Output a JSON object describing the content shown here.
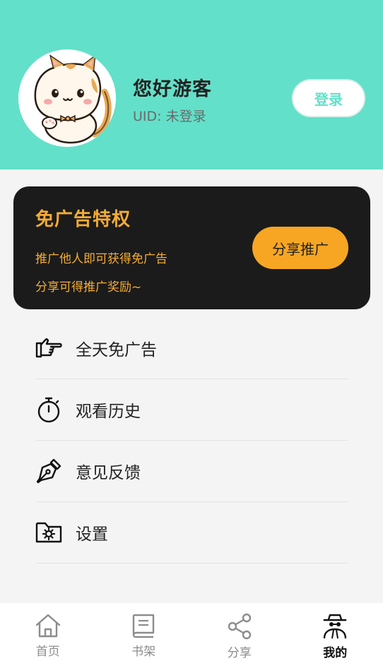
{
  "profile": {
    "greeting": "您好游客",
    "uid": "UID: 未登录",
    "login_label": "登录"
  },
  "promo": {
    "title": "免广告特权",
    "line1": "推广他人即可获得免广告",
    "line2": "分享可得推广奖励~",
    "share_label": "分享推广"
  },
  "menu": {
    "items": [
      {
        "label": "全天免广告",
        "icon": "pointing-hand-icon"
      },
      {
        "label": "观看历史",
        "icon": "stopwatch-icon"
      },
      {
        "label": "意见反馈",
        "icon": "pen-icon"
      },
      {
        "label": "设置",
        "icon": "settings-folder-icon"
      }
    ]
  },
  "tabs": [
    {
      "label": "首页",
      "icon": "home-icon",
      "active": false
    },
    {
      "label": "书架",
      "icon": "book-icon",
      "active": false
    },
    {
      "label": "分享",
      "icon": "share-icon",
      "active": false
    },
    {
      "label": "我的",
      "icon": "spy-user-icon",
      "active": true
    }
  ],
  "colors": {
    "header_bg": "#63e0c9",
    "accent": "#f4ac35",
    "promo_bg": "#1b1b1b",
    "share_button": "#f7a623"
  }
}
